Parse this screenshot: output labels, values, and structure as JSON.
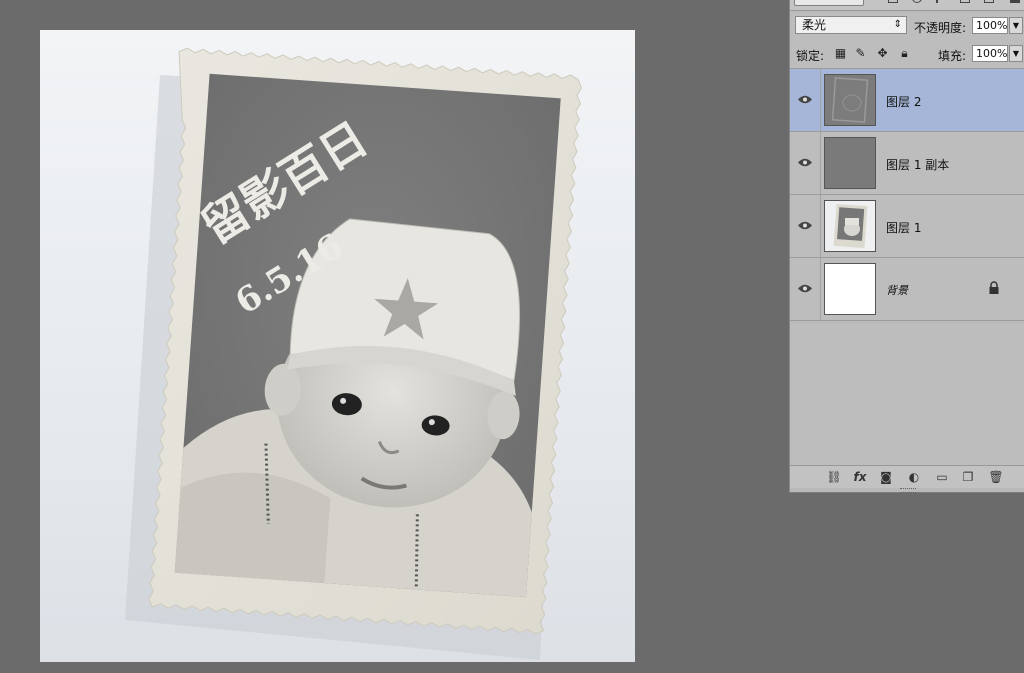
{
  "panel": {
    "blend_mode": "柔光",
    "opacity_label": "不透明度:",
    "opacity_value": "100%",
    "lock_label": "锁定:",
    "fill_label": "填充:",
    "fill_value": "100%",
    "layers": [
      {
        "name": "图层 2",
        "selected": true,
        "thumbnail": "embossed-gray",
        "visible": true
      },
      {
        "name": "图层 1 副本",
        "selected": false,
        "thumbnail": "solid-gray",
        "visible": true
      },
      {
        "name": "图层 1",
        "selected": false,
        "thumbnail": "photo",
        "visible": true
      },
      {
        "name": "背景",
        "selected": false,
        "thumbnail": "white",
        "visible": true,
        "locked": true
      }
    ],
    "bottom_icons": [
      "link-icon",
      "fx-icon",
      "mask-icon",
      "adjustment-icon",
      "folder-icon",
      "new-layer-icon",
      "trash-icon"
    ]
  },
  "canvas": {
    "photo_handwriting": "留影百日",
    "photo_date": "6.5.16",
    "colors": {
      "app_bg": "#6b6b6b",
      "selected_layer": "#a6b6d9",
      "panel_bg": "#bdbdbd"
    }
  }
}
